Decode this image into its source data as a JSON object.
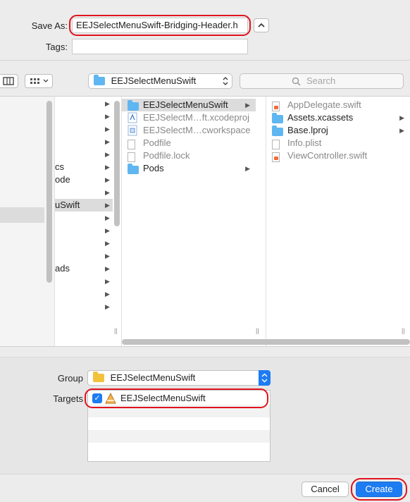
{
  "save": {
    "save_as_label": "Save As:",
    "filename": "EEJSelectMenuSwift-Bridging-Header.h",
    "tags_label": "Tags:",
    "tags_value": "",
    "expand_icon": "chevron-up-icon"
  },
  "toolbar": {
    "location": "EEJSelectMenuSwift",
    "search_placeholder": "Search",
    "view_icon": "column-view-icon",
    "group_icon": "grid-view-icon"
  },
  "sidebar": {
    "rows": [
      "cs",
      "ode",
      "uSwift",
      "ads"
    ]
  },
  "columns": {
    "project": [
      {
        "label": "EEJSelectMenuSwift",
        "icon": "folder-icon",
        "selected": true,
        "arrow": true
      },
      {
        "label": "EEJSelectM…ft.xcodeproj",
        "icon": "xcodeproj-icon",
        "grey": true
      },
      {
        "label": "EEJSelectM…cworkspace",
        "icon": "workspace-icon",
        "grey": true
      },
      {
        "label": "Podfile",
        "icon": "file-icon",
        "grey": true
      },
      {
        "label": "Podfile.lock",
        "icon": "file-icon",
        "grey": true
      },
      {
        "label": "Pods",
        "icon": "folder-icon",
        "arrow": true
      }
    ],
    "contents": [
      {
        "label": "AppDelegate.swift",
        "icon": "swift-file-icon",
        "grey": true
      },
      {
        "label": "Assets.xcassets",
        "icon": "folder-icon",
        "arrow": true
      },
      {
        "label": "Base.lproj",
        "icon": "folder-icon",
        "arrow": true
      },
      {
        "label": "Info.plist",
        "icon": "plist-file-icon",
        "grey": true
      },
      {
        "label": "ViewController.swift",
        "icon": "swift-file-icon",
        "grey": true
      }
    ]
  },
  "options": {
    "group_label": "Group",
    "group_value": "EEJSelectMenuSwift",
    "targets_label": "Targets",
    "target_name": "EEJSelectMenuSwift",
    "target_checked": true
  },
  "buttons": {
    "cancel": "Cancel",
    "create": "Create"
  },
  "colors": {
    "accent": "#1d7cf2",
    "highlight_ring": "#e0141e",
    "folder": "#5fb6f0",
    "group_folder": "#f3c23d"
  }
}
